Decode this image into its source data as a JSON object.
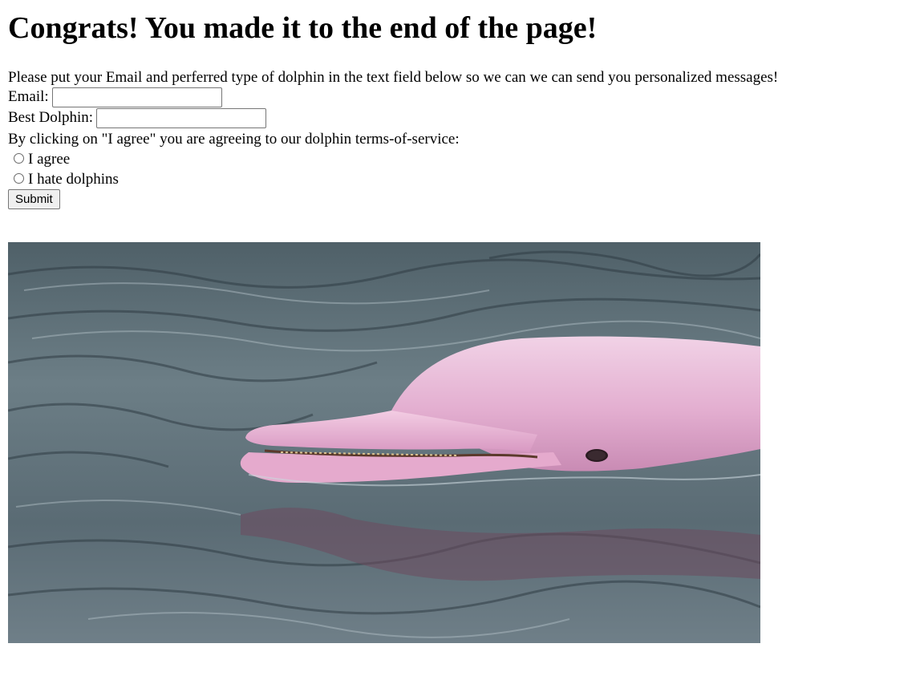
{
  "heading": "Congrats! You made it to the end of the page!",
  "intro": "Please put your Email and perferred type of dolphin in the text field below so we can we can send you personalized messages!",
  "form": {
    "email_label": "Email:",
    "email_value": "",
    "dolphin_label": "Best Dolphin:",
    "dolphin_value": "",
    "tos_text": "By clicking on \"I agree\" you are agreeing to our dolphin terms-of-service:",
    "radio_options": [
      "I agree",
      "I hate dolphins"
    ],
    "submit_label": "Submit"
  },
  "image": {
    "subject": "pink-river-dolphin-photo"
  },
  "colors": {
    "water_dark": "#3e4e58",
    "water_light": "#8a9aa2",
    "dolphin_pink": "#e6b4d4"
  }
}
